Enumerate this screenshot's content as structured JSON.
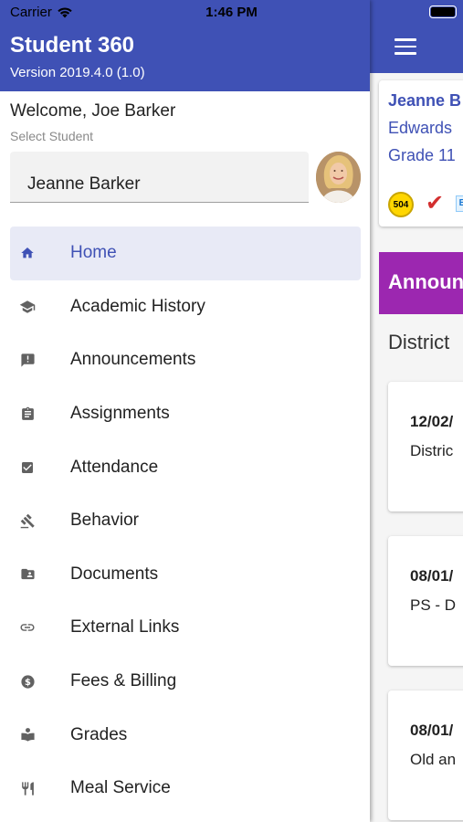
{
  "status_bar": {
    "carrier": "Carrier",
    "time": "1:46 PM"
  },
  "drawer": {
    "app_title": "Student 360",
    "version": "Version 2019.4.0 (1.0)",
    "welcome": "Welcome, Joe Barker",
    "select_label": "Select Student",
    "selected_student": "Jeanne Barker",
    "nav_items": [
      {
        "label": "Home",
        "icon": "home-icon",
        "active": true
      },
      {
        "label": "Academic History",
        "icon": "school-icon"
      },
      {
        "label": "Announcements",
        "icon": "announcement-icon"
      },
      {
        "label": "Assignments",
        "icon": "clipboard-icon"
      },
      {
        "label": "Attendance",
        "icon": "checkbox-icon"
      },
      {
        "label": "Behavior",
        "icon": "gavel-icon"
      },
      {
        "label": "Documents",
        "icon": "folder-shared-icon"
      },
      {
        "label": "External Links",
        "icon": "link-icon"
      },
      {
        "label": "Fees & Billing",
        "icon": "dollar-icon"
      },
      {
        "label": "Grades",
        "icon": "book-reader-icon"
      },
      {
        "label": "Meal Service",
        "icon": "restaurant-icon"
      }
    ]
  },
  "main": {
    "student_name": "Jeanne B",
    "school": "Edwards",
    "grade": "Grade 11",
    "badge_504": "504",
    "badge_e": "E",
    "announcements_title": "Announ",
    "district_heading": "District",
    "announcements": [
      {
        "date": "12/02/",
        "text": "Distric"
      },
      {
        "date": "08/01/",
        "text": "PS - D"
      },
      {
        "date": "08/01/",
        "text": "Old an"
      }
    ]
  },
  "colors": {
    "primary": "#3f51b5",
    "accent": "#9c27b0",
    "active_bg": "#e8eaf6"
  }
}
